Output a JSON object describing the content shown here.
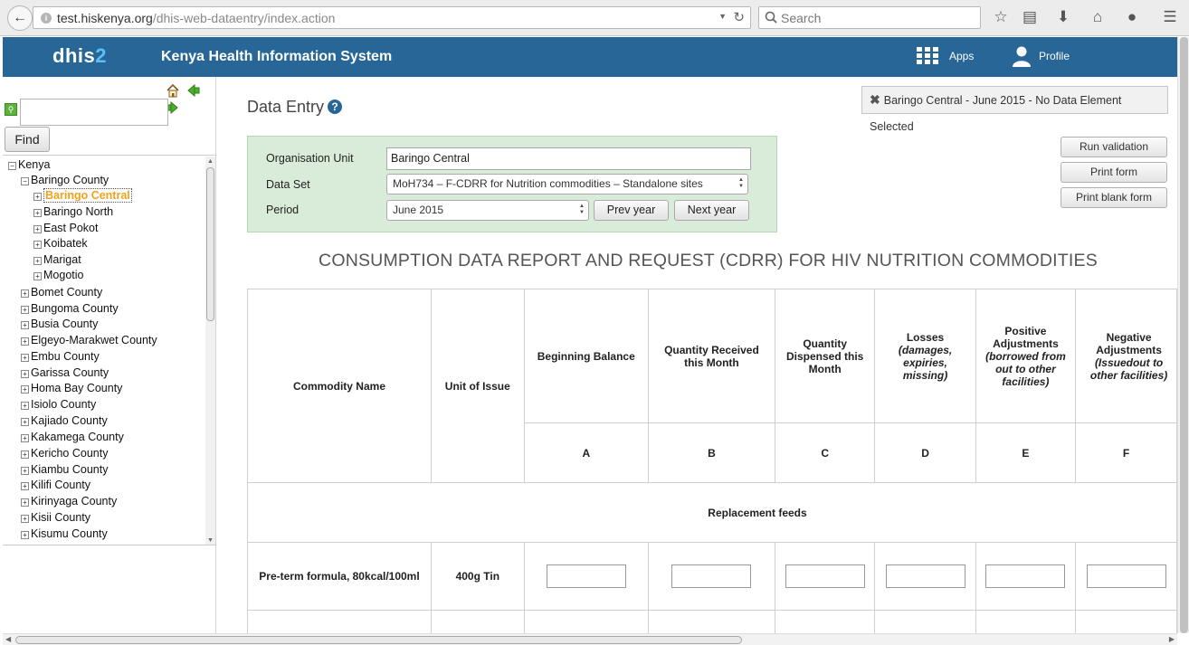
{
  "browser": {
    "url_host": "test.hiskenya.org",
    "url_path": "/dhis-web-dataentry/index.action",
    "search_placeholder": "Search"
  },
  "header": {
    "logo_text": "dhis",
    "logo_num": "2",
    "title": "Kenya Health Information System",
    "apps_label": "Apps",
    "profile_label": "Profile"
  },
  "tree": {
    "find_label": "Find",
    "nodes": [
      {
        "label": "Kenya",
        "expanded": true,
        "level": 0
      },
      {
        "label": "Baringo County",
        "expanded": true,
        "level": 1
      },
      {
        "label": "Baringo Central",
        "expanded": false,
        "level": 2,
        "selected": true
      },
      {
        "label": "Baringo North",
        "expanded": false,
        "level": 2
      },
      {
        "label": "East Pokot",
        "expanded": false,
        "level": 2
      },
      {
        "label": "Koibatek",
        "expanded": false,
        "level": 2
      },
      {
        "label": "Marigat",
        "expanded": false,
        "level": 2
      },
      {
        "label": "Mogotio",
        "expanded": false,
        "level": 2
      },
      {
        "label": "Bomet County",
        "expanded": false,
        "level": 1
      },
      {
        "label": "Bungoma County",
        "expanded": false,
        "level": 1
      },
      {
        "label": "Busia County",
        "expanded": false,
        "level": 1
      },
      {
        "label": "Elgeyo-Marakwet County",
        "expanded": false,
        "level": 1
      },
      {
        "label": "Embu County",
        "expanded": false,
        "level": 1
      },
      {
        "label": "Garissa County",
        "expanded": false,
        "level": 1
      },
      {
        "label": "Homa Bay County",
        "expanded": false,
        "level": 1
      },
      {
        "label": "Isiolo County",
        "expanded": false,
        "level": 1
      },
      {
        "label": "Kajiado County",
        "expanded": false,
        "level": 1
      },
      {
        "label": "Kakamega County",
        "expanded": false,
        "level": 1
      },
      {
        "label": "Kericho County",
        "expanded": false,
        "level": 1
      },
      {
        "label": "Kiambu County",
        "expanded": false,
        "level": 1
      },
      {
        "label": "Kilifi County",
        "expanded": false,
        "level": 1
      },
      {
        "label": "Kirinyaga County",
        "expanded": false,
        "level": 1
      },
      {
        "label": "Kisii County",
        "expanded": false,
        "level": 1
      },
      {
        "label": "Kisumu County",
        "expanded": false,
        "level": 1
      }
    ]
  },
  "main": {
    "title": "Data Entry",
    "selection_note": "Baringo Central - June 2015 - No Data Element Selected",
    "org_unit_label": "Organisation Unit",
    "org_unit_value": "Baringo Central",
    "dataset_label": "Data Set",
    "dataset_value": "MoH734 – F-CDRR for Nutrition commodities – Standalone sites",
    "period_label": "Period",
    "period_value": "June 2015",
    "prev_year_label": "Prev year",
    "next_year_label": "Next year",
    "run_validation_label": "Run validation",
    "print_form_label": "Print form",
    "print_blank_label": "Print blank form",
    "form_heading": "CONSUMPTION DATA REPORT AND REQUEST (CDRR) FOR HIV NUTRITION COMMODITIES"
  },
  "table": {
    "col_commodity": "Commodity Name",
    "col_unit": "Unit of Issue",
    "col_a": "Beginning Balance",
    "col_b": "Quantity Received this Month",
    "col_c": "Quantity Dispensed this Month",
    "col_d_main": "Losses",
    "col_d_sub": "(damages, expiries, missing)",
    "col_e_main": "Positive Adjustments",
    "col_e_sub": "(borrowed from out to other facilities)",
    "col_f_main": "Negative Adjustments",
    "col_f_sub": "(Issuedout to other facilities)",
    "letter_a": "A",
    "letter_b": "B",
    "letter_c": "C",
    "letter_d": "D",
    "letter_e": "E",
    "letter_f": "F",
    "section": "Replacement feeds",
    "row1_name": "Pre-term formula, 80kcal/100ml",
    "row1_unit": "400g Tin"
  },
  "colors": {
    "header_bg": "#276696",
    "selection_bg": "#d9ecd9",
    "selected_node": "#f3a11d"
  }
}
